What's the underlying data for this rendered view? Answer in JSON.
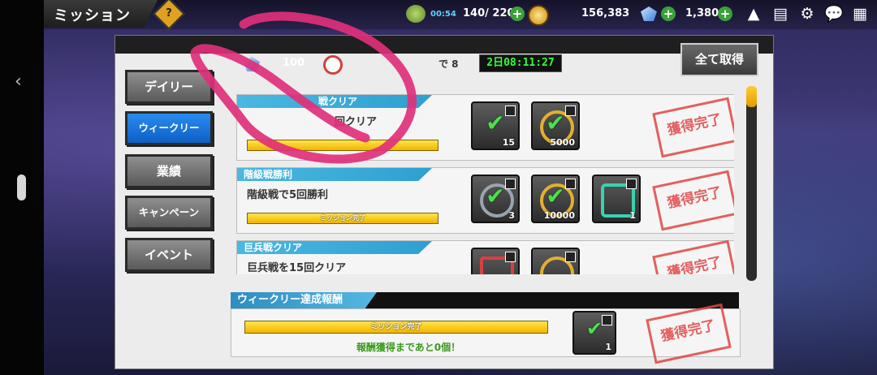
{
  "topbar": {
    "title": "ミッション",
    "help_label": "?",
    "stamina_timer": "00:54",
    "stamina": "140/ 220",
    "coins": "156,383",
    "gems": "1,380"
  },
  "panel": {
    "gem_value": "100",
    "timer_label": "で 8",
    "timer": "2日08:11:27",
    "claim_all": "全て取得"
  },
  "tabs": [
    {
      "label": "デイリー"
    },
    {
      "label": "ウィークリー"
    },
    {
      "label": "業績"
    },
    {
      "label": "キャンペーン"
    },
    {
      "label": "イベント"
    }
  ],
  "missions": [
    {
      "title": "戦クリア",
      "desc": "回クリア",
      "bar_label": "",
      "rewards": [
        "15",
        "5000"
      ],
      "stamp": "獲得完了"
    },
    {
      "title": "階級戦勝利",
      "desc": "階級戦で5回勝利",
      "bar_label": "ミッション完了",
      "rewards": [
        "3",
        "10000",
        "1"
      ],
      "stamp": "獲得完了"
    },
    {
      "title": "巨兵戦クリア",
      "desc": "巨兵戦を15回クリア",
      "bar_label": "",
      "rewards": [
        "",
        ""
      ],
      "stamp": "獲得完了"
    }
  ],
  "weekly_reward": {
    "title": "ウィークリー達成報酬",
    "bar_label": "ミッション完了",
    "note": "報酬獲得まであと0個！",
    "reward_qty": "1",
    "stamp": "獲得完了"
  },
  "icons": {
    "back": "chevron-left-icon",
    "bell": "bell-icon",
    "news": "news-icon",
    "gear": "gear-icon",
    "chat": "chat-icon",
    "menu": "grid-menu-icon"
  }
}
